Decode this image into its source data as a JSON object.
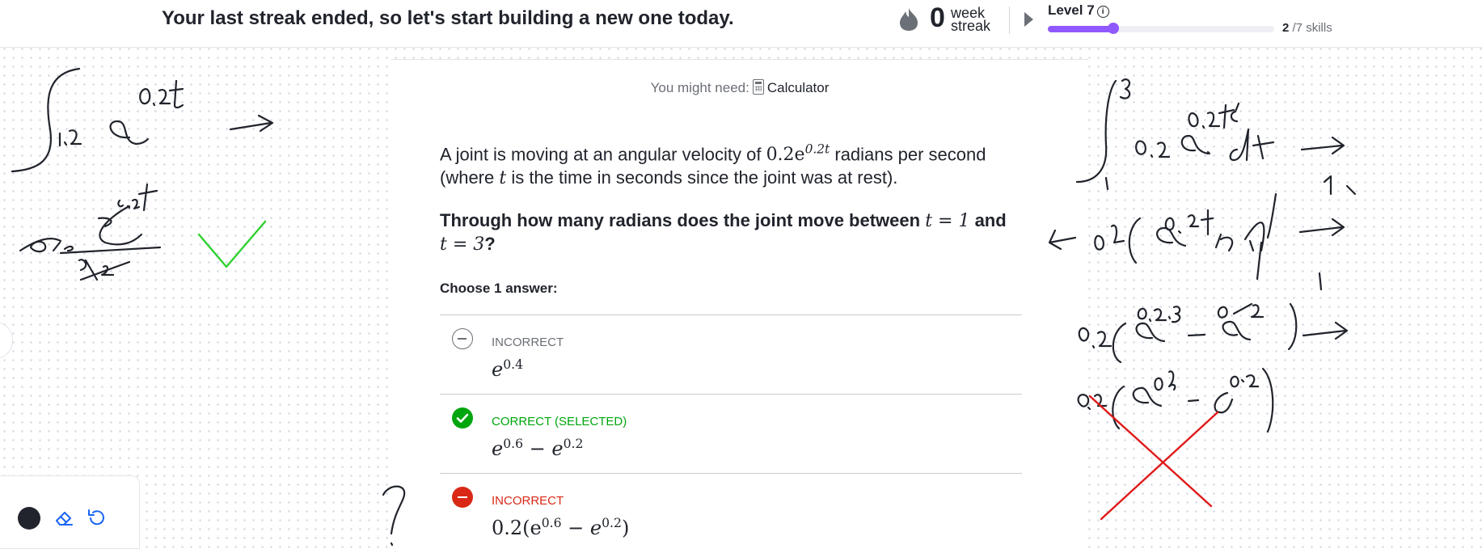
{
  "header": {
    "streak_message": "Your last streak ended, so let's start building a new one today.",
    "streak_count": "0",
    "streak_unit_line1": "week",
    "streak_unit_line2": "streak",
    "level_label": "Level 7",
    "level_progress_fraction": 0.29,
    "skills_done": "2",
    "skills_total": "/7 skills"
  },
  "exercise": {
    "might_need_label": "You might need:",
    "calculator_label": "Calculator",
    "question_part1": "A joint is moving at an angular velocity of ",
    "question_math": "0.2e",
    "question_math_exp": "0.2t",
    "question_part2": " radians per second",
    "question_part3": "(where ",
    "question_var": "t",
    "question_part4": " is the time in seconds since the joint was at rest).",
    "prompt_part1": "Through how many radians does the joint move between ",
    "prompt_math1": "t = 1",
    "prompt_part2": " and",
    "prompt_math2": "t = 3",
    "prompt_part3": "?",
    "choose_label": "Choose 1 answer:",
    "choices": [
      {
        "status": "INCORRECT",
        "state": "incorrect-unselected",
        "math_base": "e",
        "math_exp": "0.4",
        "math_rest": ""
      },
      {
        "status": "CORRECT (SELECTED)",
        "state": "correct-selected",
        "math_base": "e",
        "math_exp": "0.6",
        "math_rest": " − e",
        "math_exp2": "0.2"
      },
      {
        "status": "INCORRECT",
        "state": "incorrect-selected",
        "math_prefix": "0.2(e",
        "math_exp": "0.6",
        "math_mid": " − e",
        "math_exp2": "0.2",
        "math_suffix": ")"
      }
    ]
  },
  "colors": {
    "accent_purple": "#9059ff",
    "correct_green": "#00a60e",
    "incorrect_red": "#d92916",
    "muted_gray": "#6b6f76"
  },
  "toolbox": {
    "pen_color": "#21242c"
  }
}
